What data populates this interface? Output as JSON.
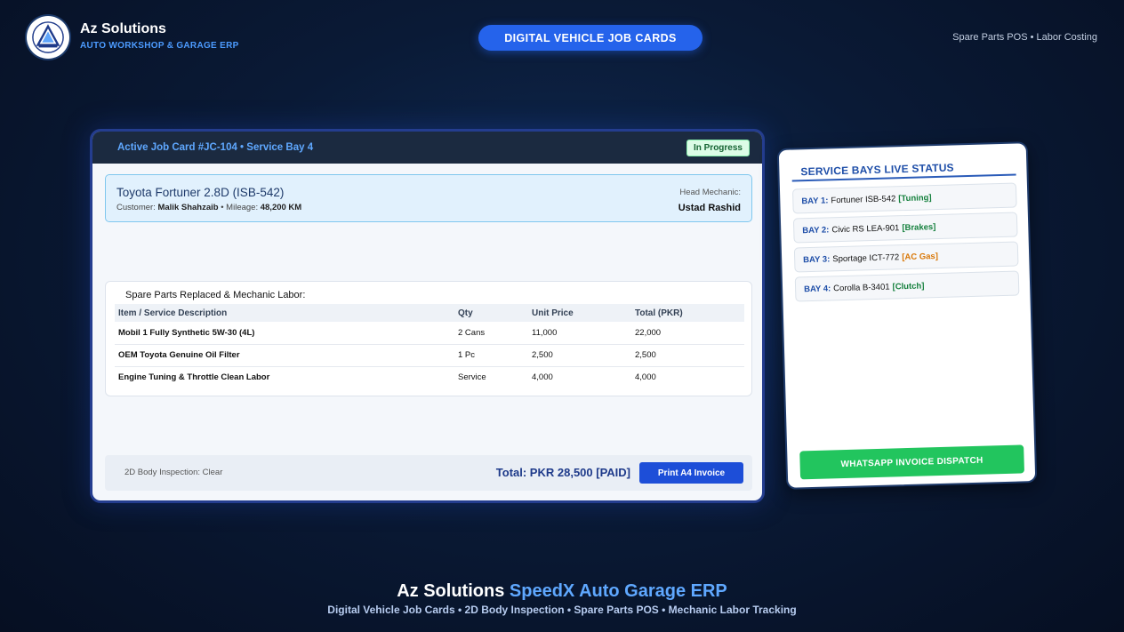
{
  "brand": {
    "name": "Az Solutions",
    "subtitle": "AUTO WORKSHOP & GARAGE ERP"
  },
  "header": {
    "pill_label": "DIGITAL VEHICLE JOB CARDS",
    "right_text": "Spare Parts POS • Labor Costing"
  },
  "job_card": {
    "title": "Active Job Card #JC-104 • Service Bay 4",
    "status": "In Progress",
    "vehicle": {
      "name": "Toyota Fortuner 2.8D (ISB-542)",
      "customer_label": "Customer:",
      "customer_name": "Malik Shahzaib",
      "mileage_label": "• Mileage:",
      "mileage": "48,200 KM",
      "mechanic_label": "Head Mechanic:",
      "mechanic_name": "Ustad Rashid"
    },
    "parts": {
      "title": "Spare Parts Replaced & Mechanic Labor:",
      "columns": [
        "Item / Service Description",
        "Qty",
        "Unit Price",
        "Total (PKR)"
      ],
      "rows": [
        [
          "Mobil 1 Fully Synthetic 5W-30 (4L)",
          "2 Cans",
          "11,000",
          "22,000"
        ],
        [
          "OEM Toyota Genuine Oil Filter",
          "1 Pc",
          "2,500",
          "2,500"
        ],
        [
          "Engine Tuning & Throttle Clean Labor",
          "Service",
          "4,000",
          "4,000"
        ]
      ]
    },
    "footer": {
      "inspection": "2D Body Inspection: Clear",
      "total": "Total: PKR 28,500 [PAID]",
      "print_label": "Print A4 Invoice"
    }
  },
  "bays": {
    "title": "SERVICE BAYS LIVE STATUS",
    "items": [
      {
        "label": "BAY 1:",
        "vehicle": "Fortuner ISB-542",
        "tag": "[Tuning]",
        "color": "#15803d"
      },
      {
        "label": "BAY 2:",
        "vehicle": "Civic RS LEA-901",
        "tag": "[Brakes]",
        "color": "#15803d"
      },
      {
        "label": "BAY 3:",
        "vehicle": "Sportage ICT-772",
        "tag": "[AC Gas]",
        "color": "#d97706"
      },
      {
        "label": "BAY 4:",
        "vehicle": "Corolla B-3401",
        "tag": "[Clutch]",
        "color": "#15803d"
      }
    ],
    "whatsapp_label": "WHATSAPP INVOICE DISPATCH"
  },
  "footer": {
    "title_main": "Az Solutions",
    "title_accent": "SpeedX Auto Garage ERP",
    "subtitle": "Digital Vehicle Job Cards • 2D Body Inspection • Spare Parts POS • Mechanic Labor Tracking"
  }
}
